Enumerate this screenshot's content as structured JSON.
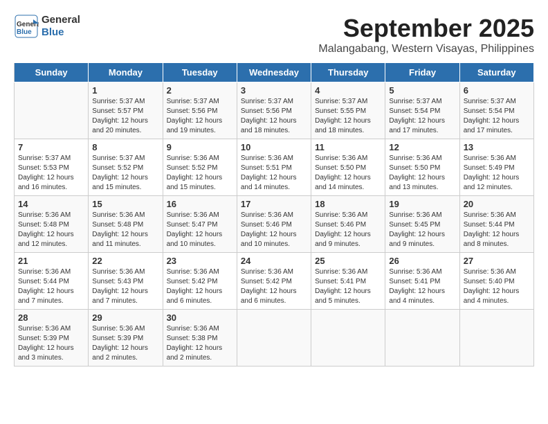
{
  "logo": {
    "line1": "General",
    "line2": "Blue"
  },
  "title": "September 2025",
  "location": "Malangabang, Western Visayas, Philippines",
  "weekdays": [
    "Sunday",
    "Monday",
    "Tuesday",
    "Wednesday",
    "Thursday",
    "Friday",
    "Saturday"
  ],
  "weeks": [
    [
      {
        "day": "",
        "content": ""
      },
      {
        "day": "1",
        "content": "Sunrise: 5:37 AM\nSunset: 5:57 PM\nDaylight: 12 hours\nand 20 minutes."
      },
      {
        "day": "2",
        "content": "Sunrise: 5:37 AM\nSunset: 5:56 PM\nDaylight: 12 hours\nand 19 minutes."
      },
      {
        "day": "3",
        "content": "Sunrise: 5:37 AM\nSunset: 5:56 PM\nDaylight: 12 hours\nand 18 minutes."
      },
      {
        "day": "4",
        "content": "Sunrise: 5:37 AM\nSunset: 5:55 PM\nDaylight: 12 hours\nand 18 minutes."
      },
      {
        "day": "5",
        "content": "Sunrise: 5:37 AM\nSunset: 5:54 PM\nDaylight: 12 hours\nand 17 minutes."
      },
      {
        "day": "6",
        "content": "Sunrise: 5:37 AM\nSunset: 5:54 PM\nDaylight: 12 hours\nand 17 minutes."
      }
    ],
    [
      {
        "day": "7",
        "content": "Sunrise: 5:37 AM\nSunset: 5:53 PM\nDaylight: 12 hours\nand 16 minutes."
      },
      {
        "day": "8",
        "content": "Sunrise: 5:37 AM\nSunset: 5:52 PM\nDaylight: 12 hours\nand 15 minutes."
      },
      {
        "day": "9",
        "content": "Sunrise: 5:36 AM\nSunset: 5:52 PM\nDaylight: 12 hours\nand 15 minutes."
      },
      {
        "day": "10",
        "content": "Sunrise: 5:36 AM\nSunset: 5:51 PM\nDaylight: 12 hours\nand 14 minutes."
      },
      {
        "day": "11",
        "content": "Sunrise: 5:36 AM\nSunset: 5:50 PM\nDaylight: 12 hours\nand 14 minutes."
      },
      {
        "day": "12",
        "content": "Sunrise: 5:36 AM\nSunset: 5:50 PM\nDaylight: 12 hours\nand 13 minutes."
      },
      {
        "day": "13",
        "content": "Sunrise: 5:36 AM\nSunset: 5:49 PM\nDaylight: 12 hours\nand 12 minutes."
      }
    ],
    [
      {
        "day": "14",
        "content": "Sunrise: 5:36 AM\nSunset: 5:48 PM\nDaylight: 12 hours\nand 12 minutes."
      },
      {
        "day": "15",
        "content": "Sunrise: 5:36 AM\nSunset: 5:48 PM\nDaylight: 12 hours\nand 11 minutes."
      },
      {
        "day": "16",
        "content": "Sunrise: 5:36 AM\nSunset: 5:47 PM\nDaylight: 12 hours\nand 10 minutes."
      },
      {
        "day": "17",
        "content": "Sunrise: 5:36 AM\nSunset: 5:46 PM\nDaylight: 12 hours\nand 10 minutes."
      },
      {
        "day": "18",
        "content": "Sunrise: 5:36 AM\nSunset: 5:46 PM\nDaylight: 12 hours\nand 9 minutes."
      },
      {
        "day": "19",
        "content": "Sunrise: 5:36 AM\nSunset: 5:45 PM\nDaylight: 12 hours\nand 9 minutes."
      },
      {
        "day": "20",
        "content": "Sunrise: 5:36 AM\nSunset: 5:44 PM\nDaylight: 12 hours\nand 8 minutes."
      }
    ],
    [
      {
        "day": "21",
        "content": "Sunrise: 5:36 AM\nSunset: 5:44 PM\nDaylight: 12 hours\nand 7 minutes."
      },
      {
        "day": "22",
        "content": "Sunrise: 5:36 AM\nSunset: 5:43 PM\nDaylight: 12 hours\nand 7 minutes."
      },
      {
        "day": "23",
        "content": "Sunrise: 5:36 AM\nSunset: 5:42 PM\nDaylight: 12 hours\nand 6 minutes."
      },
      {
        "day": "24",
        "content": "Sunrise: 5:36 AM\nSunset: 5:42 PM\nDaylight: 12 hours\nand 6 minutes."
      },
      {
        "day": "25",
        "content": "Sunrise: 5:36 AM\nSunset: 5:41 PM\nDaylight: 12 hours\nand 5 minutes."
      },
      {
        "day": "26",
        "content": "Sunrise: 5:36 AM\nSunset: 5:41 PM\nDaylight: 12 hours\nand 4 minutes."
      },
      {
        "day": "27",
        "content": "Sunrise: 5:36 AM\nSunset: 5:40 PM\nDaylight: 12 hours\nand 4 minutes."
      }
    ],
    [
      {
        "day": "28",
        "content": "Sunrise: 5:36 AM\nSunset: 5:39 PM\nDaylight: 12 hours\nand 3 minutes."
      },
      {
        "day": "29",
        "content": "Sunrise: 5:36 AM\nSunset: 5:39 PM\nDaylight: 12 hours\nand 2 minutes."
      },
      {
        "day": "30",
        "content": "Sunrise: 5:36 AM\nSunset: 5:38 PM\nDaylight: 12 hours\nand 2 minutes."
      },
      {
        "day": "",
        "content": ""
      },
      {
        "day": "",
        "content": ""
      },
      {
        "day": "",
        "content": ""
      },
      {
        "day": "",
        "content": ""
      }
    ]
  ]
}
